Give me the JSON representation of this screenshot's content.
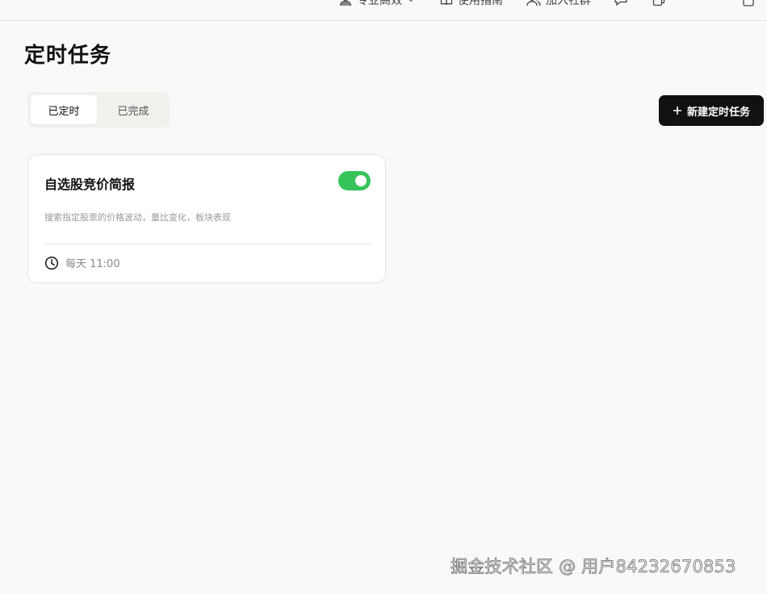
{
  "topnav": {
    "items": [
      {
        "label": "专业高效",
        "icon": "person-icon"
      },
      {
        "label": "使用指南",
        "icon": "book-icon"
      },
      {
        "label": "加入社群",
        "icon": "group-icon"
      }
    ]
  },
  "page": {
    "title": "定时任务"
  },
  "tabs": [
    {
      "label": "已定时",
      "active": true
    },
    {
      "label": "已完成",
      "active": false
    }
  ],
  "new_task_button": {
    "label": "新建定时任务",
    "icon": "plus-icon"
  },
  "tasks": [
    {
      "title": "自选股竞价简报",
      "description": "搜索指定股票的价格波动，量比变化，板块表现",
      "schedule": "每天 11:00",
      "enabled": true,
      "toggle_color": "#35c35a"
    }
  ],
  "watermark": "掘金技术社区 @ 用户84232670853"
}
